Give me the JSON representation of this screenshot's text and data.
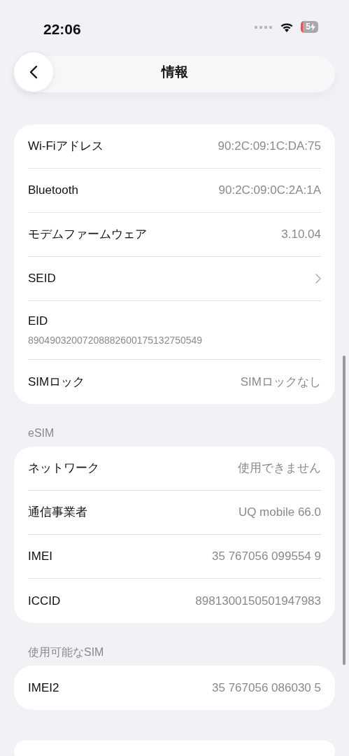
{
  "status_bar": {
    "time": "22:06",
    "battery": "5"
  },
  "nav": {
    "title": "情報"
  },
  "sections": [
    {
      "rows": [
        {
          "kind": "value",
          "label": "Wi-Fiアドレス",
          "value": "90:2C:09:1C:DA:75"
        },
        {
          "kind": "value",
          "label": "Bluetooth",
          "value": "90:2C:09:0C:2A:1A"
        },
        {
          "kind": "value",
          "label": "モデムファームウェア",
          "value": "3.10.04"
        },
        {
          "kind": "link",
          "label": "SEID"
        },
        {
          "kind": "stacked",
          "label": "EID",
          "value": "89049032007208882600175132750549"
        },
        {
          "kind": "value",
          "label": "SIMロック",
          "value": "SIMロックなし"
        }
      ]
    },
    {
      "header": "eSIM",
      "rows": [
        {
          "kind": "value",
          "label": "ネットワーク",
          "value": "使用できません"
        },
        {
          "kind": "value",
          "label": "通信事業者",
          "value": "UQ mobile 66.0"
        },
        {
          "kind": "value",
          "label": "IMEI",
          "value": "35 767056 099554 9"
        },
        {
          "kind": "value",
          "label": "ICCID",
          "value": "8981300150501947983"
        }
      ]
    },
    {
      "header": "使用可能なSIM",
      "rows": [
        {
          "kind": "value",
          "label": "IMEI2",
          "value": "35 767056 086030 5"
        }
      ]
    }
  ]
}
